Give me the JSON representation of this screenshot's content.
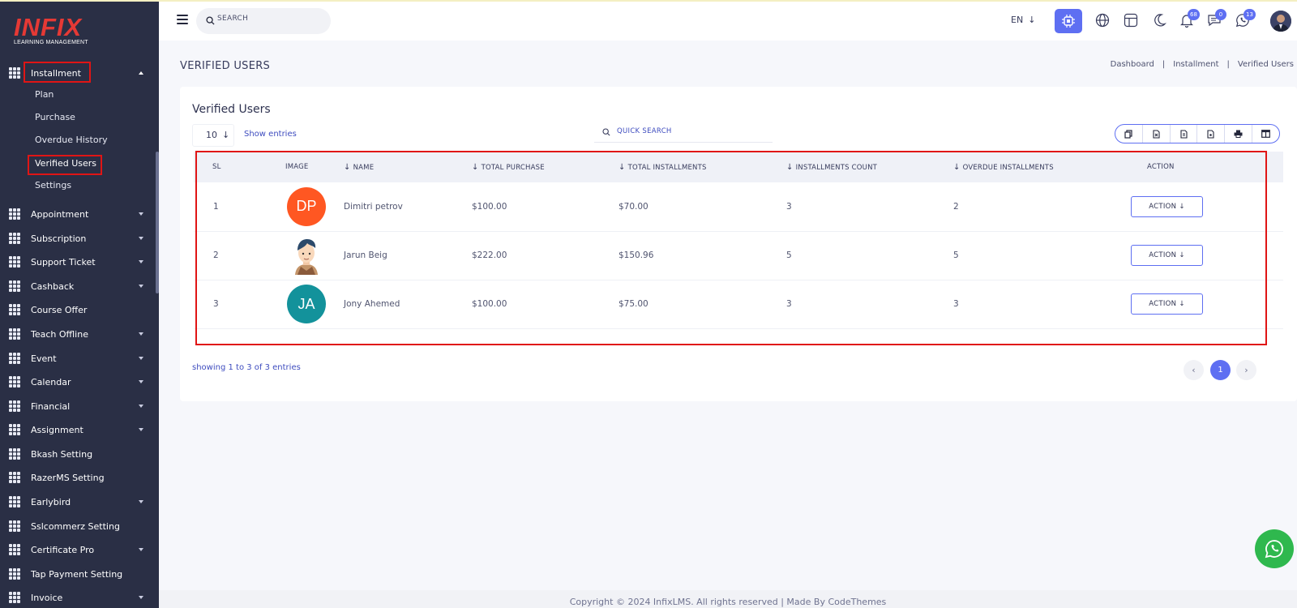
{
  "brand": {
    "name": "INFIX",
    "tagline": "LEARNING MANAGEMENT"
  },
  "sidebar": {
    "active_group": {
      "label": "Installment",
      "sub_items": [
        "Plan",
        "Purchase",
        "Overdue History",
        "Verified Users",
        "Settings"
      ],
      "active_sub": "Verified Users"
    },
    "items": [
      {
        "label": "Appointment",
        "has_caret": true
      },
      {
        "label": "Subscription",
        "has_caret": true
      },
      {
        "label": "Support Ticket",
        "has_caret": true
      },
      {
        "label": "Cashback",
        "has_caret": true
      },
      {
        "label": "Course Offer",
        "has_caret": false
      },
      {
        "label": "Teach Offline",
        "has_caret": true
      },
      {
        "label": "Event",
        "has_caret": true
      },
      {
        "label": "Calendar",
        "has_caret": true
      },
      {
        "label": "Financial",
        "has_caret": true
      },
      {
        "label": "Assignment",
        "has_caret": true
      },
      {
        "label": "Bkash Setting",
        "has_caret": false
      },
      {
        "label": "RazerMS Setting",
        "has_caret": false
      },
      {
        "label": "Earlybird",
        "has_caret": true
      },
      {
        "label": "Sslcommerz Setting",
        "has_caret": false
      },
      {
        "label": "Certificate Pro",
        "has_caret": true
      },
      {
        "label": "Tap Payment Setting",
        "has_caret": false
      },
      {
        "label": "Invoice",
        "has_caret": true
      }
    ]
  },
  "header": {
    "search_placeholder": "SEARCH",
    "language": "EN",
    "badges": {
      "notifications": "68",
      "messages": "0",
      "chat": "13"
    },
    "icons": [
      "cpu-icon",
      "globe-icon",
      "layout-icon",
      "moon-icon",
      "bell-icon",
      "message-icon",
      "whatsapp-icon"
    ]
  },
  "page": {
    "title": "VERIFIED USERS",
    "breadcrumb": [
      "Dashboard",
      "Installment",
      "Verified Users"
    ]
  },
  "card": {
    "title": "Verified Users",
    "entries_value": "10",
    "entries_label": "Show entries",
    "quick_search_placeholder": "QUICK SEARCH",
    "export_buttons": [
      "copy-icon",
      "excel-icon",
      "csv-icon",
      "pdf-icon",
      "print-icon",
      "columns-icon"
    ],
    "columns": [
      {
        "label": "SL",
        "sortable": false
      },
      {
        "label": "IMAGE",
        "sortable": false
      },
      {
        "label": "NAME",
        "sortable": true
      },
      {
        "label": "TOTAL PURCHASE",
        "sortable": true
      },
      {
        "label": "TOTAL INSTALLMENTS",
        "sortable": true
      },
      {
        "label": "INSTALLMENTS COUNT",
        "sortable": true
      },
      {
        "label": "OVERDUE INSTALLMENTS",
        "sortable": true
      },
      {
        "label": "ACTION",
        "sortable": false
      }
    ],
    "rows": [
      {
        "sl": "1",
        "initials": "DP",
        "avatar_color": "#ff5722",
        "name": "Dimitri petrov",
        "total_purchase": "$100.00",
        "total_installments": "$70.00",
        "installments_count": "3",
        "overdue": "2",
        "action": "ACTION"
      },
      {
        "sl": "2",
        "initials": "",
        "avatar_color": "",
        "name": "Jarun Beig",
        "total_purchase": "$222.00",
        "total_installments": "$150.96",
        "installments_count": "5",
        "overdue": "5",
        "action": "ACTION"
      },
      {
        "sl": "3",
        "initials": "JA",
        "avatar_color": "#13929b",
        "name": "Jony Ahemed",
        "total_purchase": "$100.00",
        "total_installments": "$75.00",
        "installments_count": "3",
        "overdue": "3",
        "action": "ACTION"
      }
    ],
    "showing_text": "showing 1 to 3 of 3 entries",
    "current_page": "1"
  },
  "footer": {
    "text": "Copyright © 2024 InfixLMS. All rights reserved | Made By CodeThemes"
  },
  "colors": {
    "sidebar_bg": "#2a2f45",
    "accent": "#5e6ff2",
    "highlight_red": "#e01515",
    "whatsapp": "#2fb84e"
  }
}
